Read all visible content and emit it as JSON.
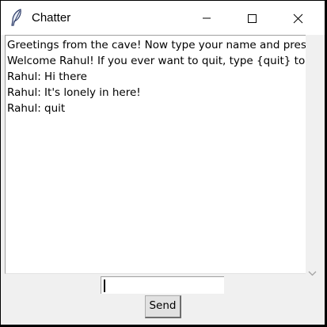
{
  "window": {
    "title": "Chatter",
    "app_icon": "feather-icon",
    "controls": {
      "minimize": "minimize-icon",
      "maximize": "maximize-icon",
      "close": "close-icon"
    }
  },
  "chat": {
    "lines": [
      "Greetings from the cave! Now type your name and press enter!",
      "Welcome Rahul! If you ever want to quit, type {quit} to exit.",
      "Rahul: Hi there",
      "Rahul: It's lonely in here!",
      "Rahul: quit"
    ]
  },
  "input": {
    "value": ""
  },
  "send_button": {
    "label": "Send"
  },
  "colors": {
    "window_bg": "#f0f0f0",
    "titlebar_bg": "#ffffff",
    "text": "#000000",
    "button_bg": "#e1e1e1"
  }
}
